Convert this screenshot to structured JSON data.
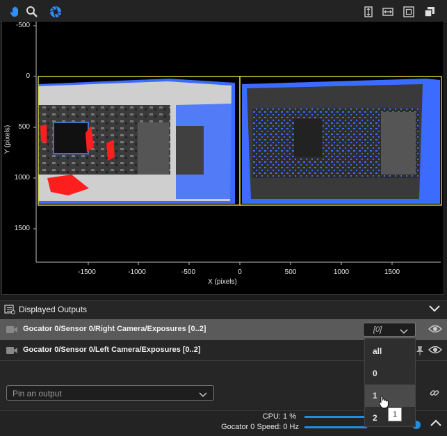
{
  "toolbar": {
    "left_icons": [
      "hand-icon",
      "magnifier-icon",
      "aperture-icon"
    ],
    "right_icons": [
      "fit-height-icon",
      "fit-width-icon",
      "fit-all-icon",
      "copy-icon"
    ]
  },
  "plot": {
    "y_label": "Y (pixels)",
    "x_label": "X (pixels)",
    "y_ticks": [
      "-500",
      "0",
      "500",
      "1000",
      "1500"
    ],
    "x_ticks": [
      "-1500",
      "-1000",
      "-500",
      "0",
      "500",
      "1000",
      "1500"
    ],
    "roi_color": "#d4c832",
    "overlay_colors": {
      "left": "#ff1e1e",
      "right": "#3c6cff"
    }
  },
  "outputs_panel": {
    "title": "Displayed Outputs",
    "rows": [
      {
        "label": "Gocator 0/Sensor 0/Right Camera/Exposures [0..2]",
        "selected_value": "[0]"
      },
      {
        "label": "Gocator 0/Sensor 0/Left Camera/Exposures [0..2]"
      }
    ],
    "pin_placeholder": "Pin an output",
    "dropdown_options": [
      "all",
      "0",
      "1",
      "2"
    ],
    "tooltip": "1"
  },
  "status": {
    "cpu_label": "CPU: 1 %",
    "speed_label": "Gocator 0 Speed: 0 Hz",
    "cpu_fraction": 0.01,
    "accent": "#1e8fe0"
  }
}
